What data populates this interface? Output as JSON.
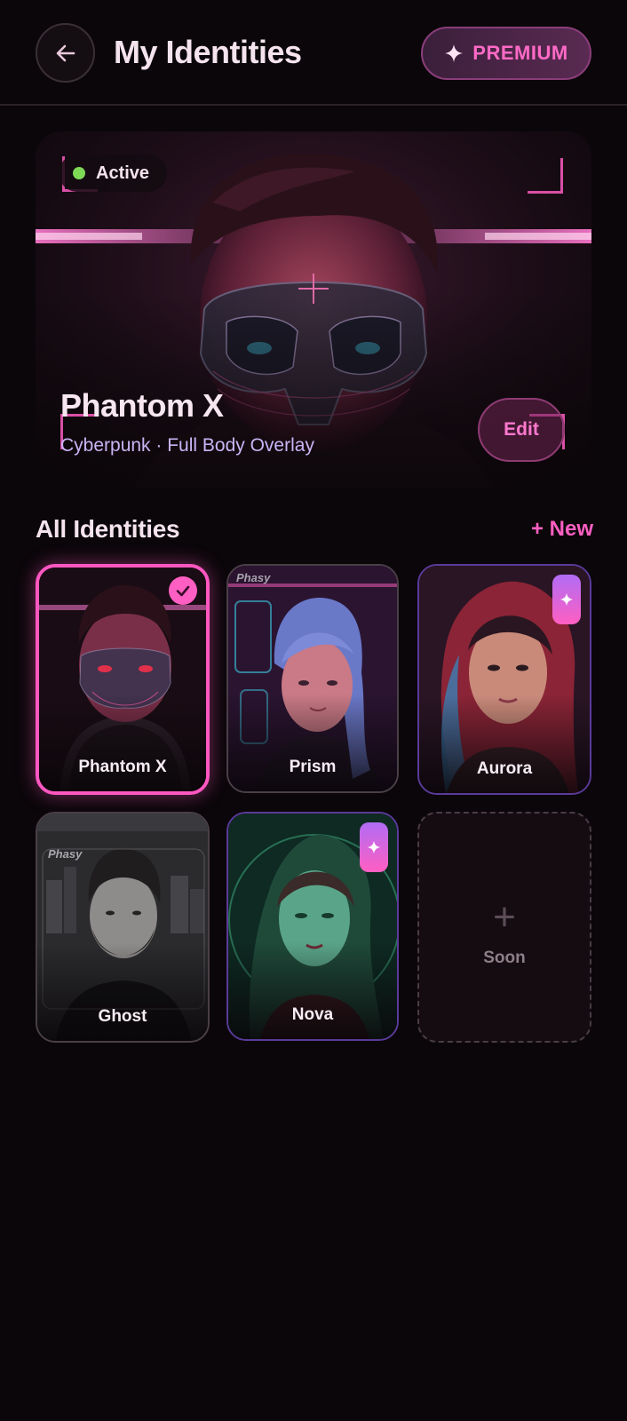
{
  "header": {
    "title": "My Identities",
    "premium_label": "PREMIUM"
  },
  "hero": {
    "status": "Active",
    "name": "Phantom X",
    "subtitle": "Cyberpunk · Full Body Overlay",
    "edit_label": "Edit"
  },
  "identities": {
    "section_title": "All Identities",
    "new_label": "+ New",
    "items": [
      {
        "name": "Phantom X",
        "selected": true
      },
      {
        "name": "Prism",
        "watermark": "Phasy"
      },
      {
        "name": "Aurora",
        "premium": true
      },
      {
        "name": "Ghost",
        "watermark": "Phasy"
      },
      {
        "name": "Nova",
        "premium": true
      }
    ],
    "soon_label": "Soon"
  },
  "colors": {
    "accent": "#ff5fc2",
    "active": "#7ed957",
    "subtitle": "#c9b4f5",
    "background": "#0a0609"
  }
}
